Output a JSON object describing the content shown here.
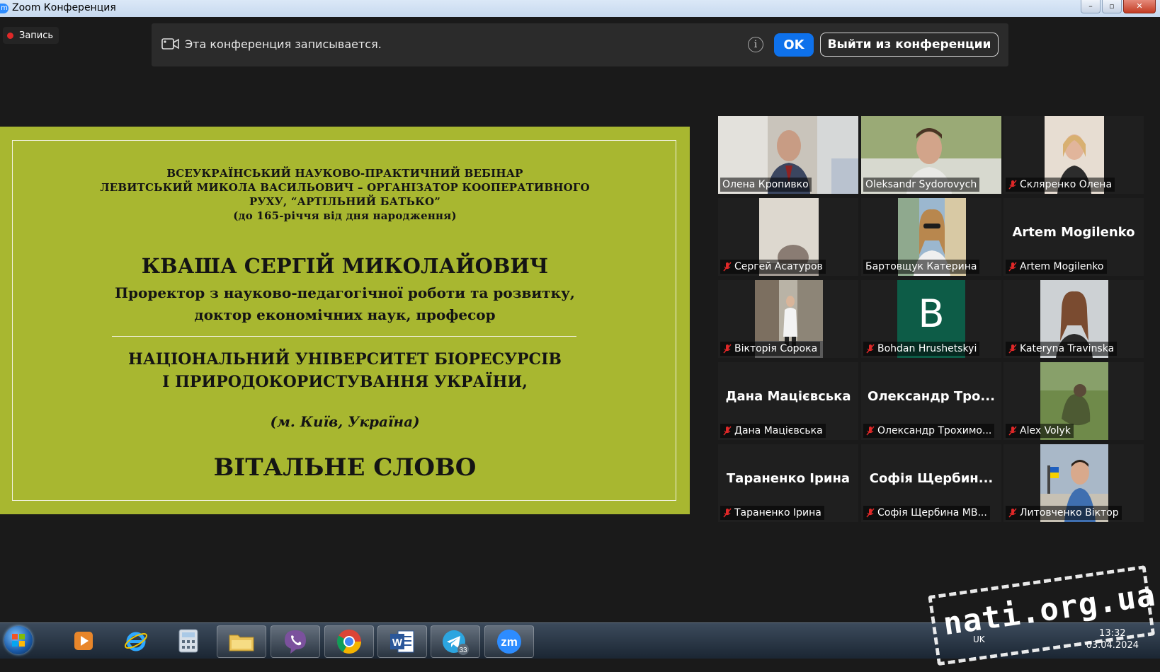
{
  "window": {
    "app_icon": "m",
    "title": "Zoom Конференция",
    "minimize_icon": "–",
    "maximize_icon": "▫",
    "close_icon": "✕"
  },
  "recording": {
    "label": "Запись"
  },
  "banner": {
    "message": "Эта конференция записывается.",
    "info_icon": "i",
    "ok_label": "OK",
    "leave_label": "Выйти из конференции"
  },
  "slide": {
    "header_line1": "ВСЕУКРАЇНСЬКИЙ НАУКОВО-ПРАКТИЧНИЙ ВЕБІНАР",
    "header_line2": "ЛЕВИТСЬКИЙ МИКОЛА ВАСИЛЬОВИЧ – ОРГАНІЗАТОР КООПЕРАТИВНОГО",
    "header_line3": "РУХУ, “АРТІЛЬНИЙ БАТЬКО”",
    "header_line4": "(до 165-річчя від дня народження)",
    "speaker_name": "КВАША СЕРГІЙ МИКОЛАЙОВИЧ",
    "position_line1": "Проректор з науково-педагогічної роботи та розвитку,",
    "position_line2": "доктор економічних наук, професор",
    "university_line1": "НАЦІОНАЛЬНИЙ УНІВЕРСИТЕТ БІОРЕСУРСІВ",
    "university_line2": "І ПРИРОДОКОРИСТУВАННЯ УКРАЇНИ,",
    "city": "(м. Київ, Україна)",
    "greeting": "ВІТАЛЬНЕ СЛОВО"
  },
  "participants": [
    {
      "name": "Олена Кропивко",
      "muted": false,
      "active": true,
      "video": true
    },
    {
      "name": "Oleksandr Sydorovych",
      "muted": false,
      "active": false,
      "video": true
    },
    {
      "name": "Скляренко Олена",
      "muted": true,
      "active": false,
      "video": true
    },
    {
      "name": "Сергей Асатуров",
      "muted": true,
      "active": false,
      "video": true
    },
    {
      "name": "Бартовщук Катерина",
      "muted": false,
      "active": false,
      "video": true
    },
    {
      "name": "Artem Mogilenko",
      "muted": true,
      "active": false,
      "video": false,
      "display": "Artem Mogilenko"
    },
    {
      "name": "Вікторія Сорока",
      "muted": true,
      "active": false,
      "video": true
    },
    {
      "name": "Bohdan Hrushetskyi",
      "muted": true,
      "active": false,
      "video": false,
      "avatar_letter": "B"
    },
    {
      "name": "Kateryna Travinska",
      "muted": true,
      "active": false,
      "video": true
    },
    {
      "name": "Дана Мацієвська",
      "muted": true,
      "active": false,
      "video": false,
      "display": "Дана Мацієвська"
    },
    {
      "name": "Олександр Трохимо...",
      "muted": true,
      "active": false,
      "video": false,
      "display": "Олександр  Тро..."
    },
    {
      "name": "Alex Volyk",
      "muted": true,
      "active": false,
      "video": true
    },
    {
      "name": "Тараненко Ірина",
      "muted": true,
      "active": false,
      "video": false,
      "display": "Тараненко Ірина"
    },
    {
      "name": "Софія Щербина МВ...",
      "muted": true,
      "active": false,
      "video": false,
      "display": "Софія  Щербин..."
    },
    {
      "name": "Литовченко Віктор",
      "muted": true,
      "active": false,
      "video": true
    }
  ],
  "taskbar": {
    "apps": [
      "media-player-icon",
      "internet-explorer-icon",
      "calculator-icon",
      "file-explorer-icon",
      "viber-icon",
      "chrome-icon",
      "word-icon",
      "telegram-icon",
      "zoom-icon"
    ],
    "telegram_badge": "33",
    "zoom_label": "zm",
    "word_label": "W",
    "clock_time": "13:32",
    "clock_date": "03.04.2024",
    "language": "UK"
  },
  "watermark": "nati.org.ua",
  "colors": {
    "zoom_blue": "#0e71eb",
    "slide_bg": "#a8b730",
    "active_speaker": "#d4e86b",
    "mute_red": "#e02828"
  }
}
